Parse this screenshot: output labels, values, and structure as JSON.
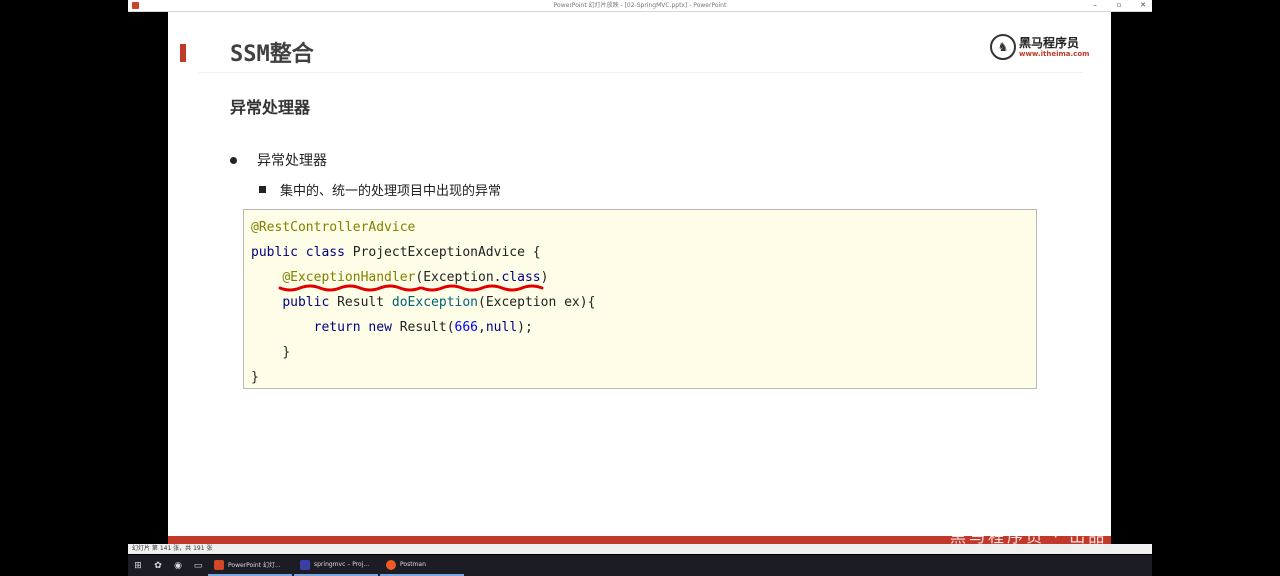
{
  "window": {
    "title": "PowerPoint 幻灯片放映 - [02-SpringMVC.pptx] - PowerPoint",
    "minimize": "–",
    "maximize": "▫",
    "close": "✕"
  },
  "slide": {
    "title": "SSM整合",
    "logo_name": "黑马程序员",
    "logo_url": "www.itheima.com",
    "subtitle": "异常处理器",
    "bullet": "异常处理器",
    "sub_bullet": "集中的、统一的处理项目中出现的异常",
    "code": {
      "l1": "@RestControllerAdvice",
      "l2_kw": "public class",
      "l2_rest": " ProjectExceptionAdvice {",
      "l3_anno": "@ExceptionHandler",
      "l3_p1": "(Exception.",
      "l3_kw": "class",
      "l3_p2": ")",
      "l4_kw": "public",
      "l4_mid": " Result ",
      "l4_method": "doException",
      "l4_rest": "(Exception ex){",
      "l5_kw1": "return",
      "l5_kw2": "new",
      "l5_mid": " Result(",
      "l5_num": "666",
      "l5_comma": ",",
      "l5_null": "null",
      "l5_end": ");",
      "l6": "}",
      "l7": "}"
    }
  },
  "statusbar": {
    "slide_counter": "幻灯片 第 141 张，共 191 张",
    "watermark": "黑马程序员 · 出品"
  },
  "taskbar": {
    "tasks": [
      {
        "label": "PowerPoint 幻灯...",
        "color": "#d24726"
      },
      {
        "label": "springmvc – Proj...",
        "color": "#3a3fa8"
      },
      {
        "label": "Postman",
        "color": "#ef5b25"
      }
    ]
  },
  "colors": {
    "accent": "#c0392b",
    "annotation": "#808000",
    "keyword": "#000080",
    "number": "#0000ff",
    "code_bg": "#fefde7"
  }
}
